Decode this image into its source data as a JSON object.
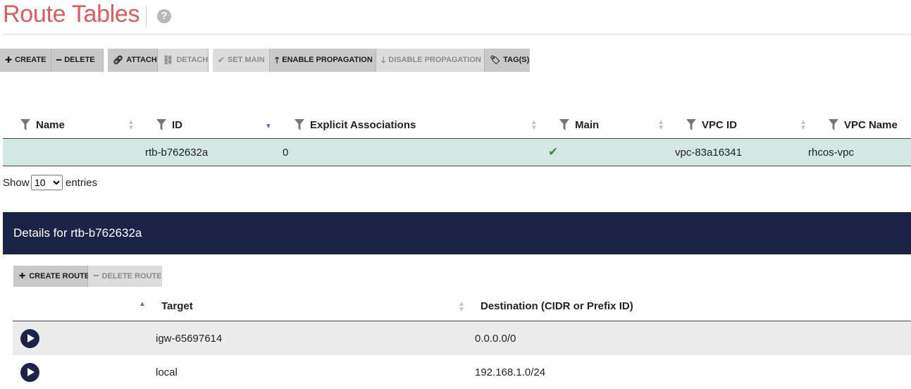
{
  "header": {
    "title": "Route Tables",
    "help_icon": "?"
  },
  "toolbar": {
    "buttons": [
      {
        "label": "CREATE",
        "icon": "plus-icon",
        "enabled": true
      },
      {
        "label": "DELETE",
        "icon": "minus-icon",
        "enabled": true
      },
      {
        "label": "ATTACH",
        "icon": "link-icon",
        "enabled": true
      },
      {
        "label": "DETACH",
        "icon": "unlink-icon",
        "enabled": false
      },
      {
        "label": "SET MAIN",
        "icon": "check-icon",
        "enabled": false
      },
      {
        "label": "ENABLE PROPAGATION",
        "icon": "arrow-up-icon",
        "enabled": true
      },
      {
        "label": "DISABLE PROPAGATION",
        "icon": "arrow-down-icon",
        "enabled": false
      },
      {
        "label": "TAG(S)",
        "icon": "tag-icon",
        "enabled": true
      }
    ]
  },
  "route_table": {
    "columns": [
      "Name",
      "ID",
      "Explicit Associations",
      "Main",
      "VPC ID",
      "VPC Name"
    ],
    "rows": [
      {
        "name": "",
        "id": "rtb-b762632a",
        "explicit_associations": "0",
        "main": true,
        "vpc_id": "vpc-83a16341",
        "vpc_name": "rhcos-vpc"
      }
    ]
  },
  "pagination": {
    "show_label": "Show",
    "entries_value": "10",
    "entries_options": [
      "10"
    ],
    "entries_label": "entries"
  },
  "details": {
    "title": "Details for rtb-b762632a",
    "buttons": [
      {
        "label": "CREATE ROUTE",
        "icon": "plus-icon",
        "enabled": true
      },
      {
        "label": "DELETE ROUTE",
        "icon": "minus-icon",
        "enabled": false
      }
    ],
    "columns": [
      "Target",
      "Destination (CIDR or Prefix ID)"
    ],
    "routes": [
      {
        "target": "igw-65697614",
        "destination": "0.0.0.0/0"
      },
      {
        "target": "local",
        "destination": "192.168.1.0/24"
      }
    ]
  },
  "colors": {
    "title": "#e05a5a",
    "panel_header": "#1b2446",
    "selected_row": "#d4e8e3",
    "check": "#3a8a3a"
  }
}
